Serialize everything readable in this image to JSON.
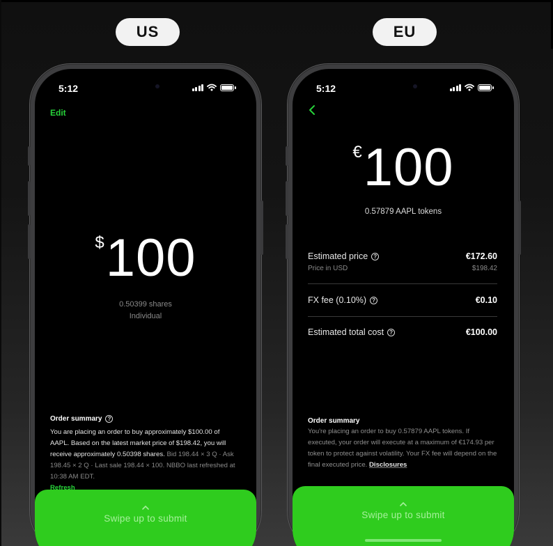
{
  "labels": {
    "us": "US",
    "eu": "EU"
  },
  "colors": {
    "accent": "#27d33a",
    "swipe_bg": "#2fcc1e"
  },
  "us_phone": {
    "status_time": "5:12",
    "edit_label": "Edit",
    "currency_symbol": "$",
    "amount": "100",
    "shares": "0.50399 shares",
    "account": "Individual",
    "summary_title": "Order summary",
    "summary_main": "You are placing an order to buy approximately $100.00 of AAPL. Based on the latest market price of $198.42, you will receive approximately 0.50398 shares.",
    "summary_dim": "Bid 198.44 × 3 Q · Ask 198.45 × 2 Q · Last sale 198.44 × 100. NBBO last refreshed at 10:38 AM EDT.",
    "refresh_label": "Refresh",
    "swipe_label": "Swipe up to submit"
  },
  "eu_phone": {
    "status_time": "5:12",
    "back_icon": "chevron-left-icon",
    "currency_symbol": "€",
    "amount": "100",
    "tokens": "0.57879 AAPL tokens",
    "estimated_price_label": "Estimated price",
    "estimated_price_value": "€172.60",
    "price_usd_label": "Price in USD",
    "price_usd_value": "$198.42",
    "fx_fee_label": "FX fee (0.10%)",
    "fx_fee_value": "€0.10",
    "total_label": "Estimated total cost",
    "total_value": "€100.00",
    "summary_title": "Order summary",
    "summary_main": "You're placing an order to buy 0.57879 AAPL tokens. If executed, your order will execute at a maximum of €174.93 per token to protect against volatility. Your FX fee will depend on the final executed price.",
    "disclosures_label": "Disclosures",
    "swipe_label": "Swipe up to submit"
  }
}
